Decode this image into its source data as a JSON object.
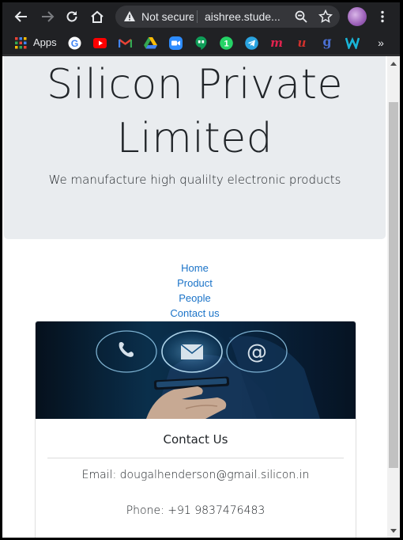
{
  "browser": {
    "security_status": "Not secure",
    "url": "aishree.stude...",
    "bookmarks_apps_label": "Apps",
    "more_bookmarks_label": "»",
    "bookmark_icons": [
      "google-icon",
      "youtube-icon",
      "gmail-icon",
      "drive-icon",
      "zoom-icon",
      "hangouts-icon",
      "whatsapp-icon",
      "telegram-icon",
      "m-red-icon",
      "u-red-icon",
      "g-blue-icon",
      "w-cyan-icon"
    ]
  },
  "page": {
    "title": "Silicon Private Limited",
    "title_line1": "Silicon Private",
    "title_line2": "Limited",
    "lead": "We manufacture high qualilty electronic products",
    "nav": [
      "Home",
      "Product",
      "People",
      "Contact us"
    ],
    "card": {
      "title": "Contact Us",
      "email": "Email: dougalhenderson@gmail.silicon.in",
      "phone": "Phone: +91 9837476483"
    }
  },
  "colors": {
    "browser_bg": "#202124",
    "jumbotron_bg": "#e9ecef",
    "link": "#1a73c8"
  }
}
